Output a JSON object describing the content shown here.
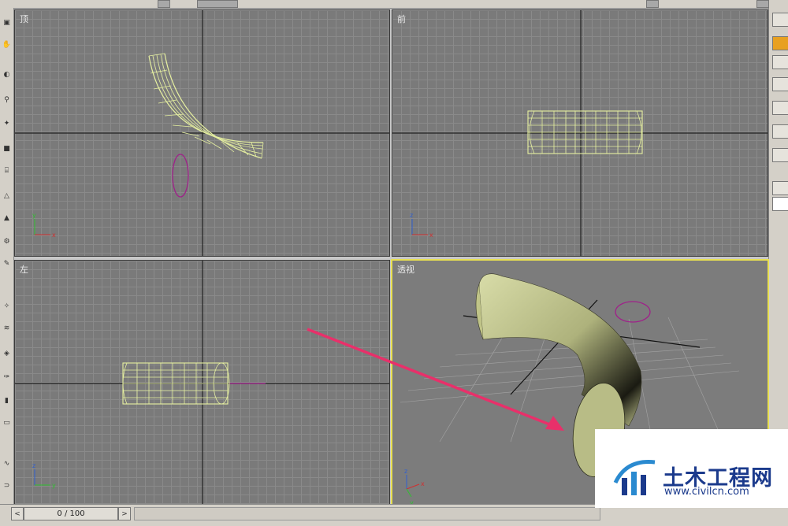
{
  "viewports": {
    "top": {
      "label": "顶"
    },
    "front": {
      "label": "前"
    },
    "left": {
      "label": "左"
    },
    "perspective": {
      "label": "透视"
    }
  },
  "axis_gizmo": {
    "x": "x",
    "y": "y",
    "z": "z"
  },
  "timeline": {
    "frame_display": "0 / 100",
    "prev_arrow": "<",
    "next_arrow": ">"
  },
  "watermark": {
    "title": "土木工程网",
    "url": "www.civilcn.com"
  },
  "colors": {
    "viewport_bg": "#7a7a7a",
    "grid": "#8a8a8a",
    "active_border": "#e8e050",
    "wireframe": "#e6f0a0",
    "ellipse": "#a0208a",
    "annotation_arrow": "#e8306a",
    "shaded_object": "#c8cc98",
    "watermark_blue": "#1b3a8c"
  },
  "icons": [
    "select-icon",
    "sphere-icon",
    "create-panel-icon",
    "arrow-annotation-icon"
  ]
}
